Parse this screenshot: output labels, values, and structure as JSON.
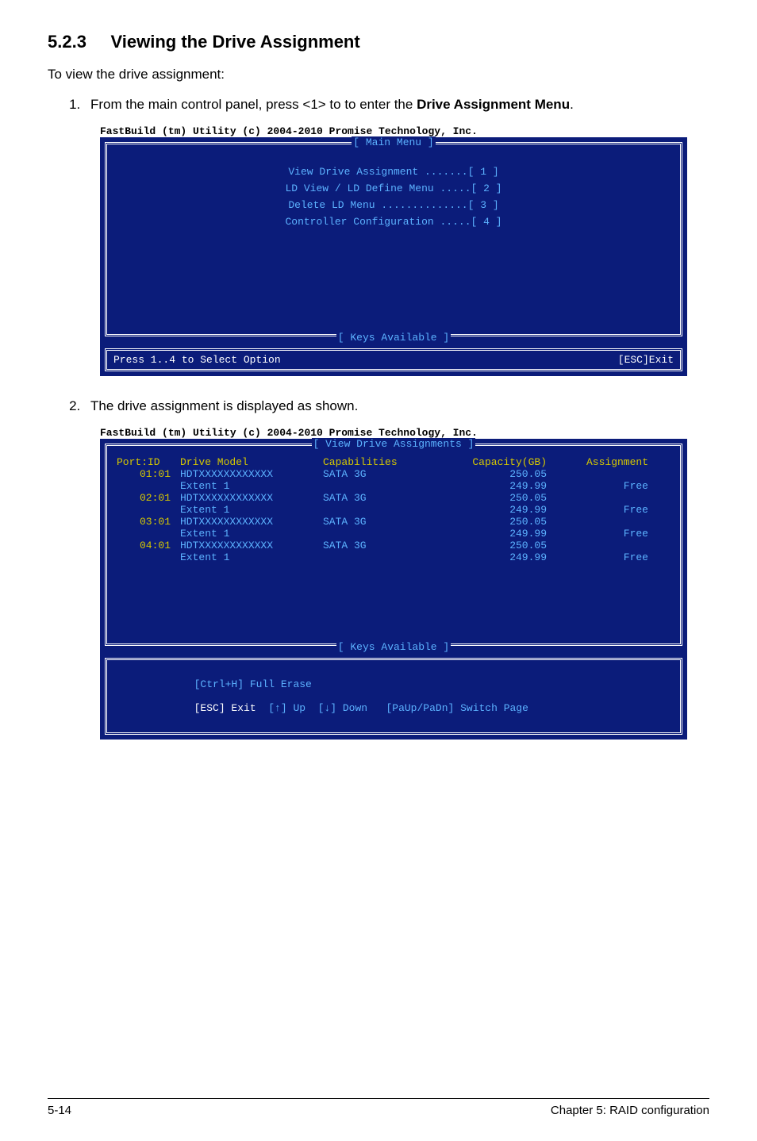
{
  "heading_number": "5.2.3",
  "heading_text": "Viewing the Drive Assignment",
  "intro": "To view the drive assignment:",
  "step1": "From the main control panel, press <1> to to enter the ",
  "step1_bold": "Drive Assignment Menu",
  "step1_period": ".",
  "console_label": "FastBuild (tm) Utility (c) 2004-2010 Promise Technology, Inc.",
  "main_menu_title": "[ Main Menu ]",
  "menu_items": [
    "View Drive Assignment .......[ 1 ]",
    "LD View / LD Define Menu .....[ 2 ]",
    "Delete LD Menu ..............[ 3 ]",
    "Controller Configuration .....[ 4 ]"
  ],
  "keys_available_title": "[ Keys Available ]",
  "keys_line_left": "Press 1..4 to Select Option",
  "keys_line_right": "[ESC]Exit",
  "step2": "The drive assignment is displayed as shown.",
  "view_title": "[ View Drive Assignments ]",
  "columns": {
    "port": "Port:ID",
    "model": "Drive Model",
    "cap": "Capabilities",
    "gb": "Capacity(GB)",
    "asg": "Assignment"
  },
  "drives": [
    {
      "port": "01:01",
      "model": "HDTXXXXXXXXXXXX",
      "cap": "SATA 3G",
      "gb": "250.05",
      "extent": "Extent 1",
      "egb": "249.99",
      "asg": "Free"
    },
    {
      "port": "02:01",
      "model": "HDTXXXXXXXXXXXX",
      "cap": "SATA 3G",
      "gb": "250.05",
      "extent": "Extent 1",
      "egb": "249.99",
      "asg": "Free"
    },
    {
      "port": "03:01",
      "model": "HDTXXXXXXXXXXXX",
      "cap": "SATA 3G",
      "gb": "250.05",
      "extent": "Extent 1",
      "egb": "249.99",
      "asg": "Free"
    },
    {
      "port": "04:01",
      "model": "HDTXXXXXXXXXXXX",
      "cap": "SATA 3G",
      "gb": "250.05",
      "extent": "Extent 1",
      "egb": "249.99",
      "asg": "Free"
    }
  ],
  "keys2_line1": "[Ctrl+H] Full Erase",
  "keys2_line2_esc": "[ESC] Exit",
  "keys2_line2_up": "  [↑] Up",
  "keys2_line2_down": "  [↓] Down",
  "keys2_line2_page": "   [PaUp/PaDn] Switch Page",
  "footer_left": "5-14",
  "footer_right": "Chapter 5: RAID configuration"
}
